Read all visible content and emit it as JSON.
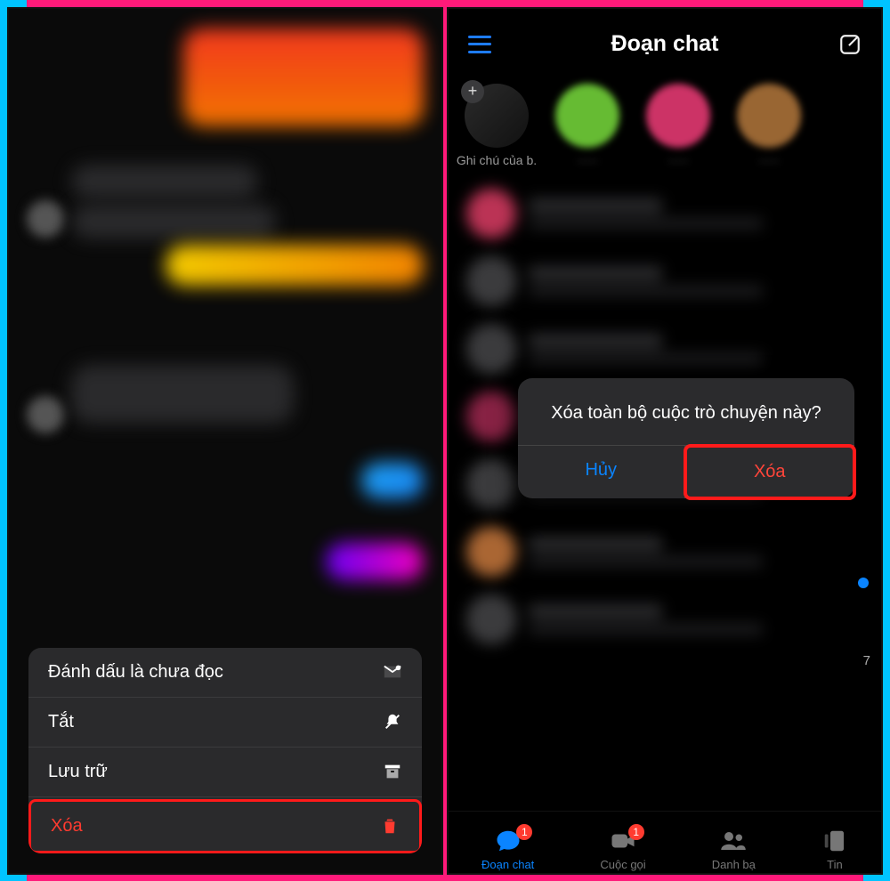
{
  "left": {
    "action_sheet": {
      "mark_unread": "Đánh dấu là chưa đọc",
      "mute": "Tắt",
      "archive": "Lưu trữ",
      "delete": "Xóa"
    }
  },
  "right": {
    "header": {
      "title": "Đoạn chat"
    },
    "story_own_label": "Ghi chú của b.",
    "alert": {
      "title": "Xóa toàn bộ cuộc trò chuyện này?",
      "cancel": "Hủy",
      "delete": "Xóa"
    },
    "badge_7": "7",
    "tabs": {
      "chats": {
        "label": "Đoạn chat",
        "badge": "1"
      },
      "calls": {
        "label": "Cuộc gọi",
        "badge": "1"
      },
      "people": {
        "label": "Danh bạ"
      },
      "stories": {
        "label": "Tin"
      }
    }
  }
}
